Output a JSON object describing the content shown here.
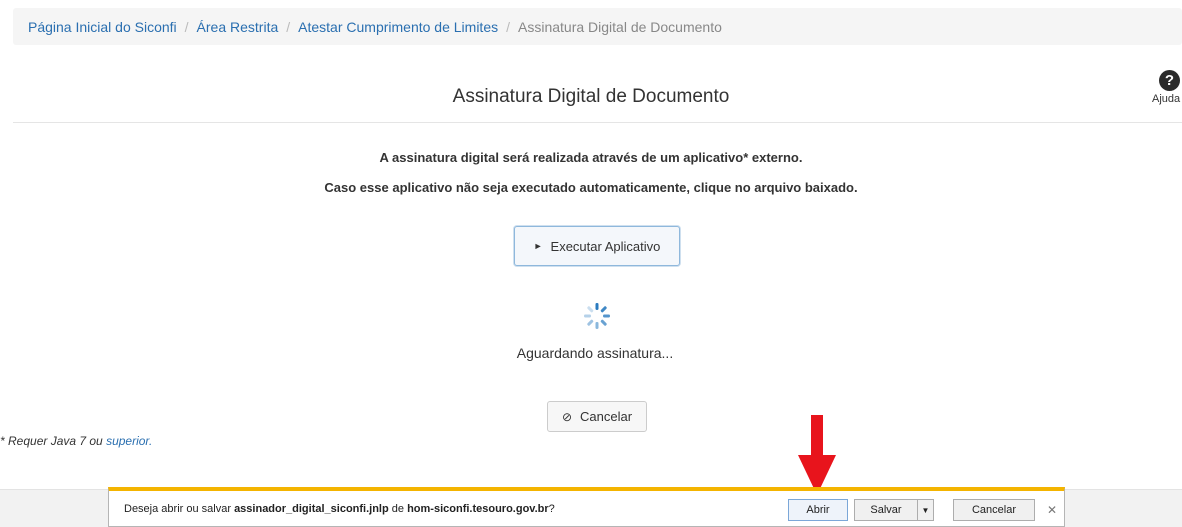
{
  "breadcrumb": {
    "items": [
      "Página Inicial do Siconfi",
      "Área Restrita",
      "Atestar Cumprimento de Limites"
    ],
    "current": "Assinatura Digital de Documento",
    "separator": "/"
  },
  "header": {
    "title": "Assinatura Digital de Documento",
    "help_icon": "?",
    "help_label": "Ajuda"
  },
  "message": {
    "line1": "A assinatura digital será realizada através de um aplicativo* externo.",
    "line2": "Caso esse aplicativo não seja executado automaticamente, clique no arquivo baixado."
  },
  "actions": {
    "execute_icon": "►",
    "execute_label": "Executar Aplicativo",
    "cancel_icon": "⊘",
    "cancel_label": "Cancelar"
  },
  "status": {
    "waiting_text": "Aguardando assinatura..."
  },
  "note": {
    "prefix": "* Requer Java 7 ou ",
    "link": "superior."
  },
  "download_bar": {
    "prefix": "Deseja abrir ou salvar ",
    "filename": "assinador_digital_siconfi.jnlp",
    "middle": " de ",
    "host": "hom-siconfi.tesouro.gov.br",
    "suffix": "?",
    "open_label": "Abrir",
    "save_label": "Salvar",
    "dropdown_icon": "▼",
    "cancel_label": "Cancelar",
    "close_icon": "✕"
  },
  "colors": {
    "link": "#2a6fb0",
    "arrow": "#e8141c",
    "download_bar_accent": "#f4b400",
    "spinner": "#2a7bbf"
  }
}
